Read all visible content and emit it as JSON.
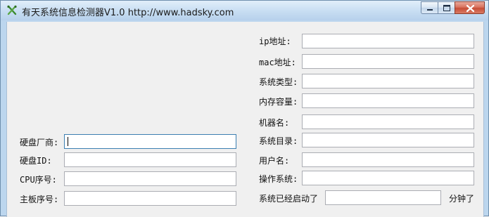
{
  "window": {
    "title": "有天系统信息检测器V1.0  http://www.hadsky.com",
    "accent_color": "#bcd6ee",
    "close_color": "#c74e37",
    "buttons": {
      "minimize_icon": "minimize-icon",
      "maximize_icon": "maximize-icon",
      "close_icon": "close-icon"
    }
  },
  "form": {
    "ip": {
      "label": "ip地址:",
      "value": ""
    },
    "mac": {
      "label": "mac地址:",
      "value": ""
    },
    "os_type": {
      "label": "系统类型:",
      "value": ""
    },
    "memory": {
      "label": "内存容量:",
      "value": ""
    },
    "machine_name": {
      "label": "机器名:",
      "value": ""
    },
    "sys_dir": {
      "label": "系统目录:",
      "value": ""
    },
    "username": {
      "label": "用户名:",
      "value": ""
    },
    "os": {
      "label": "操作系统:",
      "value": ""
    },
    "uptime": {
      "label": "系统已经启动了",
      "value": "",
      "unit": "分钟了"
    },
    "disk_vendor": {
      "label": "硬盘厂商:",
      "value": ""
    },
    "disk_id": {
      "label": "硬盘ID:",
      "value": ""
    },
    "cpu_serial": {
      "label": "CPU序号:",
      "value": ""
    },
    "board_serial": {
      "label": "主板序号:",
      "value": ""
    }
  }
}
